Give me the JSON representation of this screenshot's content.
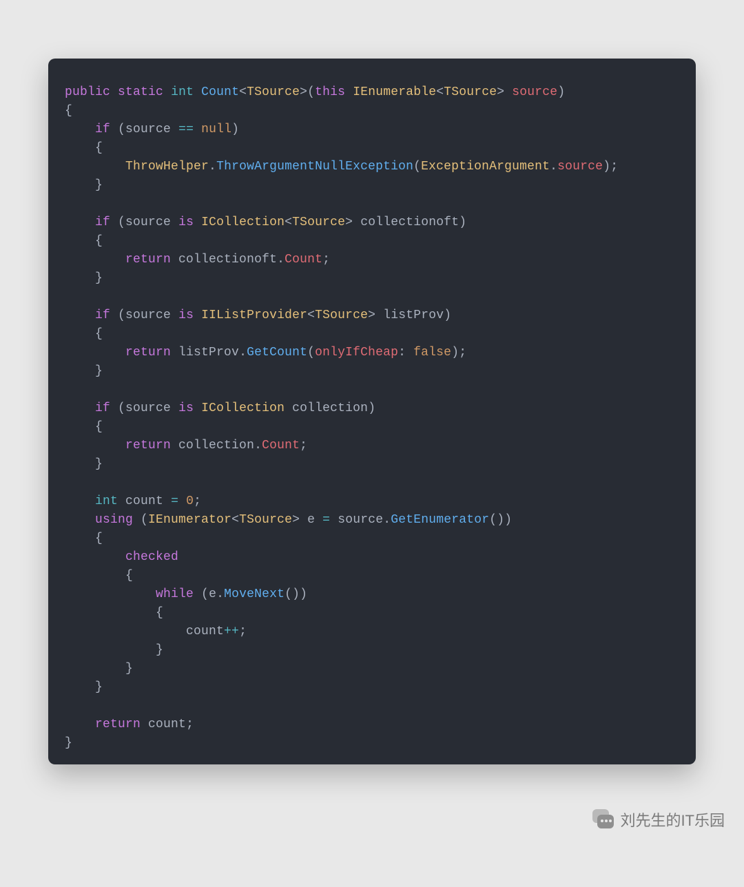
{
  "colors": {
    "page_bg": "#e8e8e8",
    "card_bg": "#282c34",
    "text_default": "#abb2bf",
    "keyword": "#c678dd",
    "type": "#56b6c2",
    "typename": "#e5c07b",
    "method": "#61afef",
    "param": "#e06c75",
    "number": "#d19a66"
  },
  "watermark": {
    "text": "刘先生的IT乐园",
    "icon": "wechat-bubble-icon"
  },
  "code": {
    "language": "csharp",
    "tokens": [
      [
        [
          "public",
          "keyword"
        ],
        [
          " ",
          "plain"
        ],
        [
          "static",
          "keyword"
        ],
        [
          " ",
          "plain"
        ],
        [
          "int",
          "type"
        ],
        [
          " ",
          "plain"
        ],
        [
          "Count",
          "method"
        ],
        [
          "<",
          "punc"
        ],
        [
          "TSource",
          "typename"
        ],
        [
          ">",
          "punc"
        ],
        [
          "(",
          "punc"
        ],
        [
          "this",
          "keyword"
        ],
        [
          " ",
          "plain"
        ],
        [
          "IEnumerable",
          "typename"
        ],
        [
          "<",
          "punc"
        ],
        [
          "TSource",
          "typename"
        ],
        [
          ">",
          "punc"
        ],
        [
          " ",
          "plain"
        ],
        [
          "source",
          "param"
        ],
        [
          ")",
          "punc"
        ]
      ],
      [
        [
          "{",
          "punc"
        ]
      ],
      [
        [
          "    ",
          "plain"
        ],
        [
          "if",
          "keyword"
        ],
        [
          " (",
          "punc"
        ],
        [
          "source",
          "plain"
        ],
        [
          " ",
          "plain"
        ],
        [
          "==",
          "op"
        ],
        [
          " ",
          "plain"
        ],
        [
          "null",
          "bool"
        ],
        [
          ")",
          "punc"
        ]
      ],
      [
        [
          "    {",
          "punc"
        ]
      ],
      [
        [
          "        ",
          "plain"
        ],
        [
          "ThrowHelper",
          "typename"
        ],
        [
          ".",
          "punc"
        ],
        [
          "ThrowArgumentNullException",
          "call"
        ],
        [
          "(",
          "punc"
        ],
        [
          "ExceptionArgument",
          "typename"
        ],
        [
          ".",
          "punc"
        ],
        [
          "source",
          "prop"
        ],
        [
          ");",
          "punc"
        ]
      ],
      [
        [
          "    }",
          "punc"
        ]
      ],
      [],
      [
        [
          "    ",
          "plain"
        ],
        [
          "if",
          "keyword"
        ],
        [
          " (",
          "punc"
        ],
        [
          "source",
          "plain"
        ],
        [
          " ",
          "plain"
        ],
        [
          "is",
          "keyword"
        ],
        [
          " ",
          "plain"
        ],
        [
          "ICollection",
          "typename"
        ],
        [
          "<",
          "punc"
        ],
        [
          "TSource",
          "typename"
        ],
        [
          ">",
          "punc"
        ],
        [
          " ",
          "plain"
        ],
        [
          "collectionoft",
          "plain"
        ],
        [
          ")",
          "punc"
        ]
      ],
      [
        [
          "    {",
          "punc"
        ]
      ],
      [
        [
          "        ",
          "plain"
        ],
        [
          "return",
          "keyword"
        ],
        [
          " ",
          "plain"
        ],
        [
          "collectionoft",
          "plain"
        ],
        [
          ".",
          "punc"
        ],
        [
          "Count",
          "prop"
        ],
        [
          ";",
          "punc"
        ]
      ],
      [
        [
          "    }",
          "punc"
        ]
      ],
      [],
      [
        [
          "    ",
          "plain"
        ],
        [
          "if",
          "keyword"
        ],
        [
          " (",
          "punc"
        ],
        [
          "source",
          "plain"
        ],
        [
          " ",
          "plain"
        ],
        [
          "is",
          "keyword"
        ],
        [
          " ",
          "plain"
        ],
        [
          "IIListProvider",
          "typename"
        ],
        [
          "<",
          "punc"
        ],
        [
          "TSource",
          "typename"
        ],
        [
          ">",
          "punc"
        ],
        [
          " ",
          "plain"
        ],
        [
          "listProv",
          "plain"
        ],
        [
          ")",
          "punc"
        ]
      ],
      [
        [
          "    {",
          "punc"
        ]
      ],
      [
        [
          "        ",
          "plain"
        ],
        [
          "return",
          "keyword"
        ],
        [
          " ",
          "plain"
        ],
        [
          "listProv",
          "plain"
        ],
        [
          ".",
          "punc"
        ],
        [
          "GetCount",
          "call"
        ],
        [
          "(",
          "punc"
        ],
        [
          "onlyIfCheap",
          "param"
        ],
        [
          ":",
          "punc"
        ],
        [
          " ",
          "plain"
        ],
        [
          "false",
          "bool"
        ],
        [
          ");",
          "punc"
        ]
      ],
      [
        [
          "    }",
          "punc"
        ]
      ],
      [],
      [
        [
          "    ",
          "plain"
        ],
        [
          "if",
          "keyword"
        ],
        [
          " (",
          "punc"
        ],
        [
          "source",
          "plain"
        ],
        [
          " ",
          "plain"
        ],
        [
          "is",
          "keyword"
        ],
        [
          " ",
          "plain"
        ],
        [
          "ICollection",
          "typename"
        ],
        [
          " ",
          "plain"
        ],
        [
          "collection",
          "plain"
        ],
        [
          ")",
          "punc"
        ]
      ],
      [
        [
          "    {",
          "punc"
        ]
      ],
      [
        [
          "        ",
          "plain"
        ],
        [
          "return",
          "keyword"
        ],
        [
          " ",
          "plain"
        ],
        [
          "collection",
          "plain"
        ],
        [
          ".",
          "punc"
        ],
        [
          "Count",
          "prop"
        ],
        [
          ";",
          "punc"
        ]
      ],
      [
        [
          "    }",
          "punc"
        ]
      ],
      [],
      [
        [
          "    ",
          "plain"
        ],
        [
          "int",
          "type"
        ],
        [
          " ",
          "plain"
        ],
        [
          "count",
          "plain"
        ],
        [
          " ",
          "plain"
        ],
        [
          "=",
          "op"
        ],
        [
          " ",
          "plain"
        ],
        [
          "0",
          "num"
        ],
        [
          ";",
          "punc"
        ]
      ],
      [
        [
          "    ",
          "plain"
        ],
        [
          "using",
          "keyword"
        ],
        [
          " (",
          "punc"
        ],
        [
          "IEnumerator",
          "typename"
        ],
        [
          "<",
          "punc"
        ],
        [
          "TSource",
          "typename"
        ],
        [
          ">",
          "punc"
        ],
        [
          " ",
          "plain"
        ],
        [
          "e",
          "plain"
        ],
        [
          " ",
          "plain"
        ],
        [
          "=",
          "op"
        ],
        [
          " ",
          "plain"
        ],
        [
          "source",
          "plain"
        ],
        [
          ".",
          "punc"
        ],
        [
          "GetEnumerator",
          "call"
        ],
        [
          "())",
          "punc"
        ]
      ],
      [
        [
          "    {",
          "punc"
        ]
      ],
      [
        [
          "        ",
          "plain"
        ],
        [
          "checked",
          "keyword"
        ]
      ],
      [
        [
          "        {",
          "punc"
        ]
      ],
      [
        [
          "            ",
          "plain"
        ],
        [
          "while",
          "keyword"
        ],
        [
          " (",
          "punc"
        ],
        [
          "e",
          "plain"
        ],
        [
          ".",
          "punc"
        ],
        [
          "MoveNext",
          "call"
        ],
        [
          "())",
          "punc"
        ]
      ],
      [
        [
          "            {",
          "punc"
        ]
      ],
      [
        [
          "                ",
          "plain"
        ],
        [
          "count",
          "plain"
        ],
        [
          "++",
          "op"
        ],
        [
          ";",
          "punc"
        ]
      ],
      [
        [
          "            }",
          "punc"
        ]
      ],
      [
        [
          "        }",
          "punc"
        ]
      ],
      [
        [
          "    }",
          "punc"
        ]
      ],
      [],
      [
        [
          "    ",
          "plain"
        ],
        [
          "return",
          "keyword"
        ],
        [
          " ",
          "plain"
        ],
        [
          "count",
          "plain"
        ],
        [
          ";",
          "punc"
        ]
      ],
      [
        [
          "}",
          "punc"
        ]
      ]
    ]
  }
}
